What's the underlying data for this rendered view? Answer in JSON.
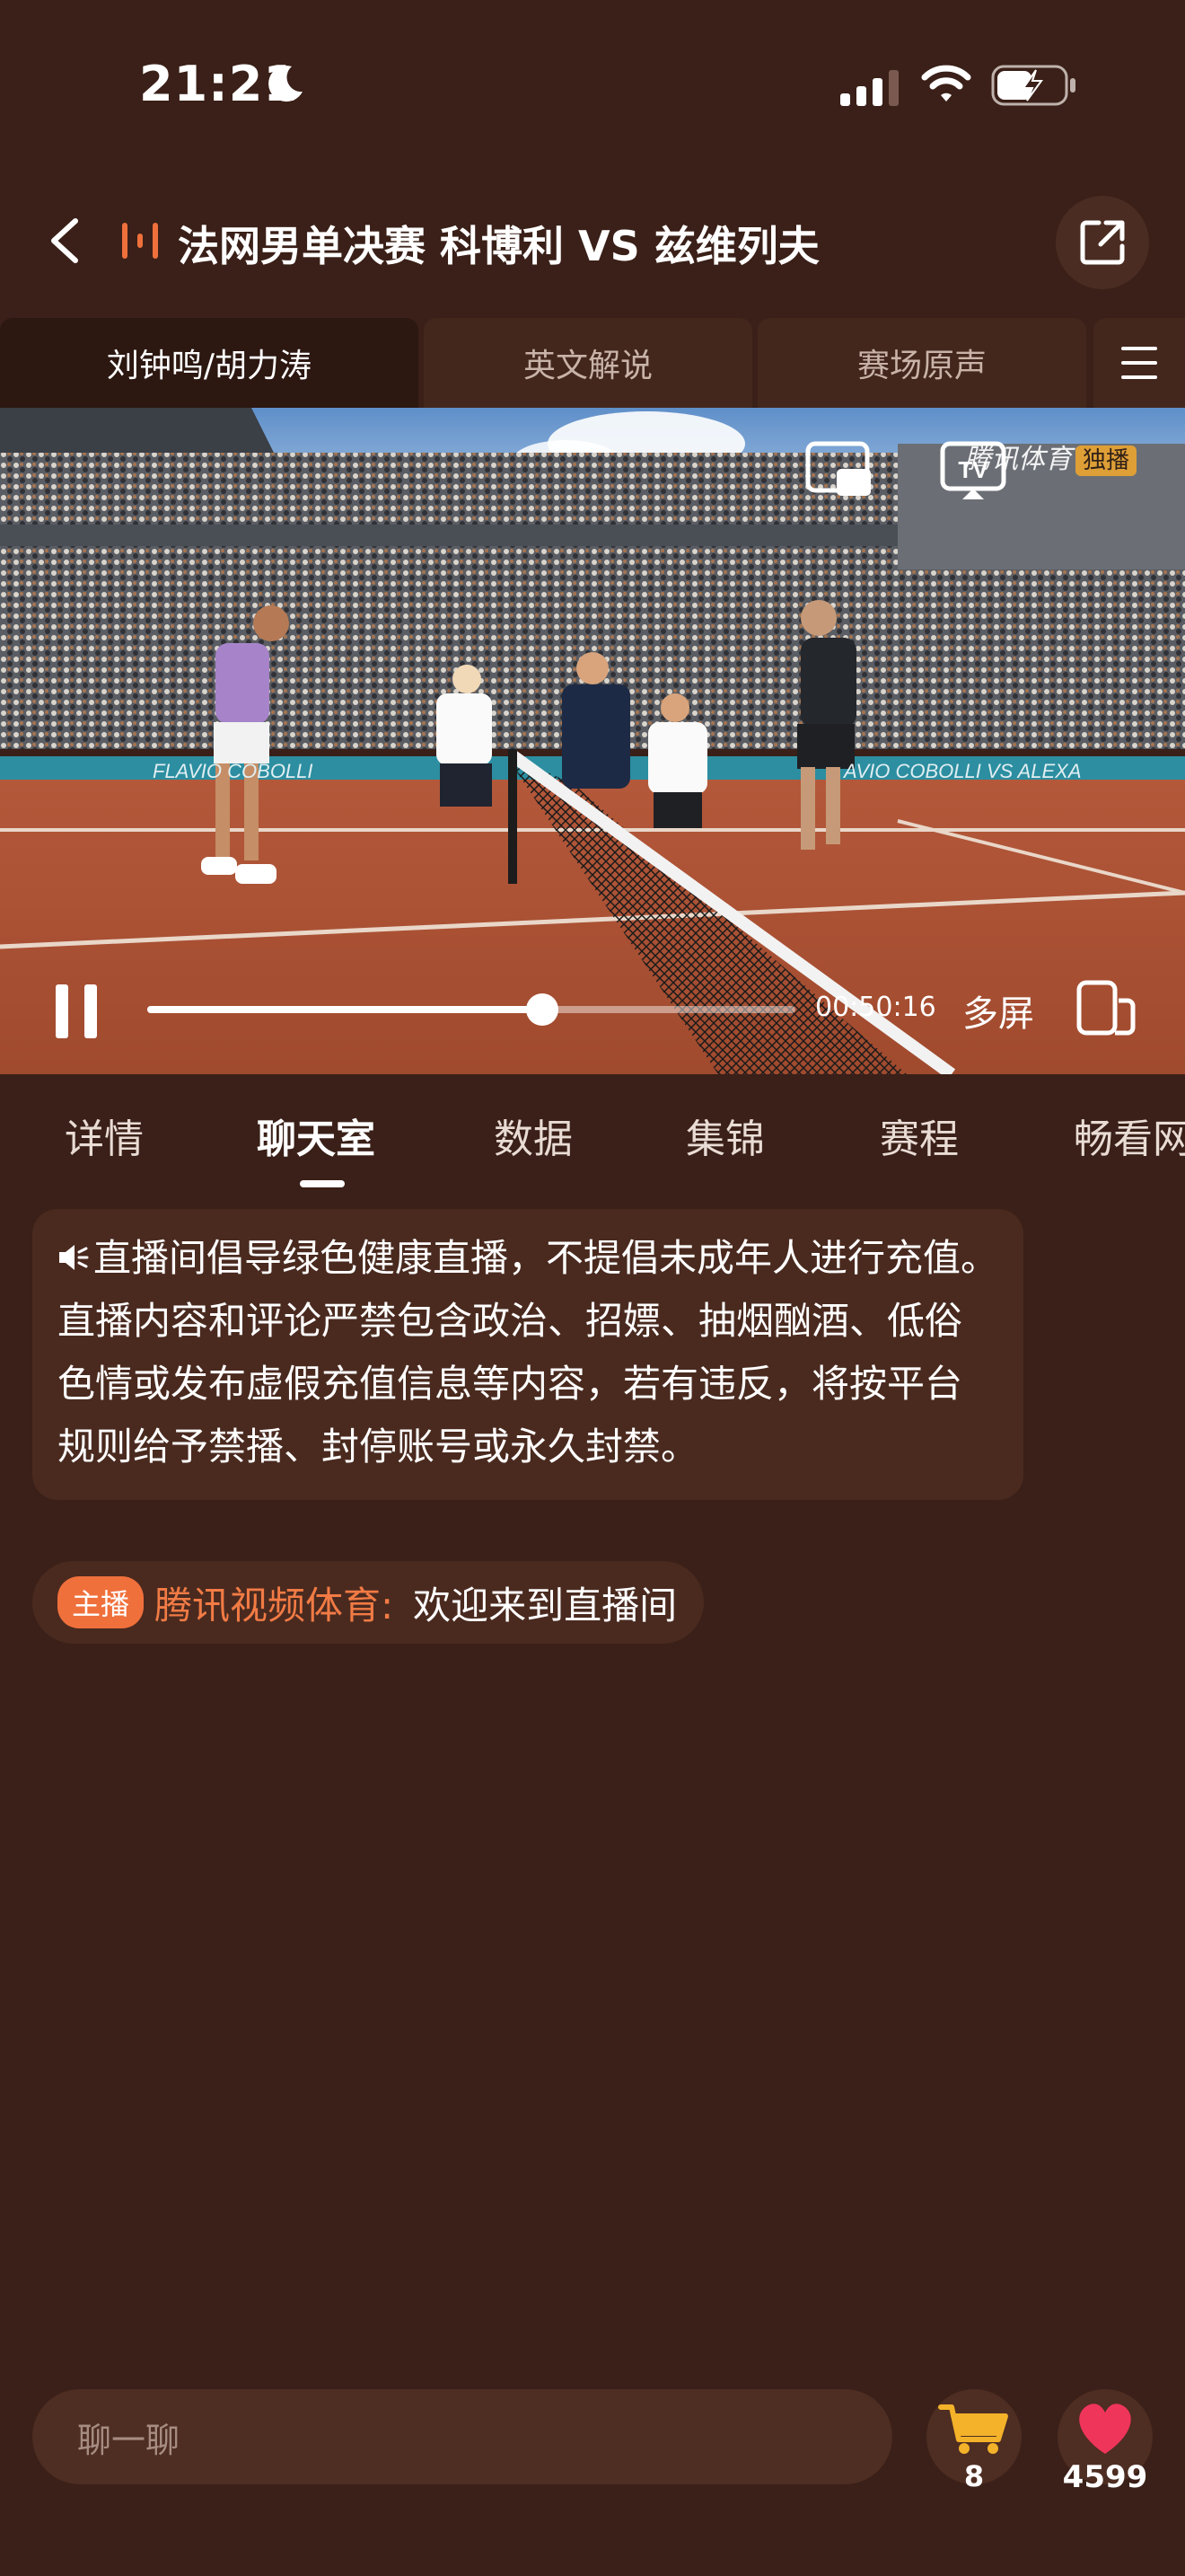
{
  "status_bar": {
    "time": "21:21"
  },
  "header": {
    "title": "法网男单决赛 科博利 VS 兹维列夫"
  },
  "commentary_tabs": [
    {
      "label": "刘钟鸣/胡力涛"
    },
    {
      "label": "英文解说"
    },
    {
      "label": "赛场原声"
    }
  ],
  "player": {
    "brand": "腾讯体育",
    "brand_badge": "独播",
    "elapsed": "00:50:16",
    "progress_fraction": 0.61,
    "multi_screen_label": "多屏"
  },
  "tabs": [
    {
      "label": "详情"
    },
    {
      "label": "聊天室"
    },
    {
      "label": "数据"
    },
    {
      "label": "集锦"
    },
    {
      "label": "赛程"
    },
    {
      "label": "畅看网"
    }
  ],
  "chat": {
    "notice": "直播间倡导绿色健康直播，不提倡未成年人进行充值。直播内容和评论严禁包含政治、招嫖、抽烟酗酒、低俗色情或发布虚假充值信息等内容，若有违反，将按平台规则给予禁播、封停账号或永久封禁。",
    "messages": [
      {
        "badge": "主播",
        "sender": "腾讯视频体育:",
        "text": "欢迎来到直播间"
      }
    ]
  },
  "bottom_bar": {
    "input_placeholder": "聊一聊",
    "cart_count": "8",
    "like_count": "4599"
  },
  "colors": {
    "background": "#3a2018",
    "accent_orange": "#f0703c",
    "like_red": "#f0355a",
    "cart_yellow": "#f3b229"
  }
}
